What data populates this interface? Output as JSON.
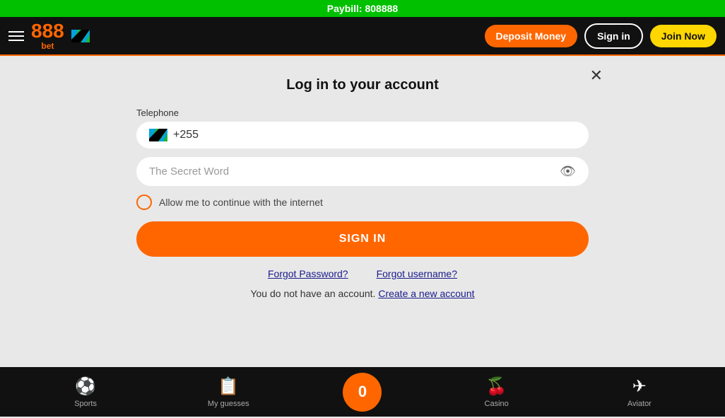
{
  "paybill": {
    "text": "Paybill: 808888"
  },
  "header": {
    "logo_888": "888",
    "logo_bet": "bet",
    "deposit_label": "Deposit Money",
    "signin_label": "Sign in",
    "joinnow_label": "Join Now"
  },
  "login_form": {
    "title": "Log in to your account",
    "telephone_label": "Telephone",
    "phone_code": "+255",
    "password_placeholder": "The Secret Word",
    "checkbox_label": "Allow me to continue with the internet",
    "sign_in_button": "SIGN IN",
    "forgot_password": "Forgot Password?",
    "forgot_username": "Forgot username?",
    "no_account_text": "You do not have an account.",
    "create_account": "Create a new account"
  },
  "bottom_nav": {
    "sports_label": "Sports",
    "myguesses_label": "My guesses",
    "center_count": "0",
    "casino_label": "Casino",
    "aviator_label": "Aviator"
  }
}
